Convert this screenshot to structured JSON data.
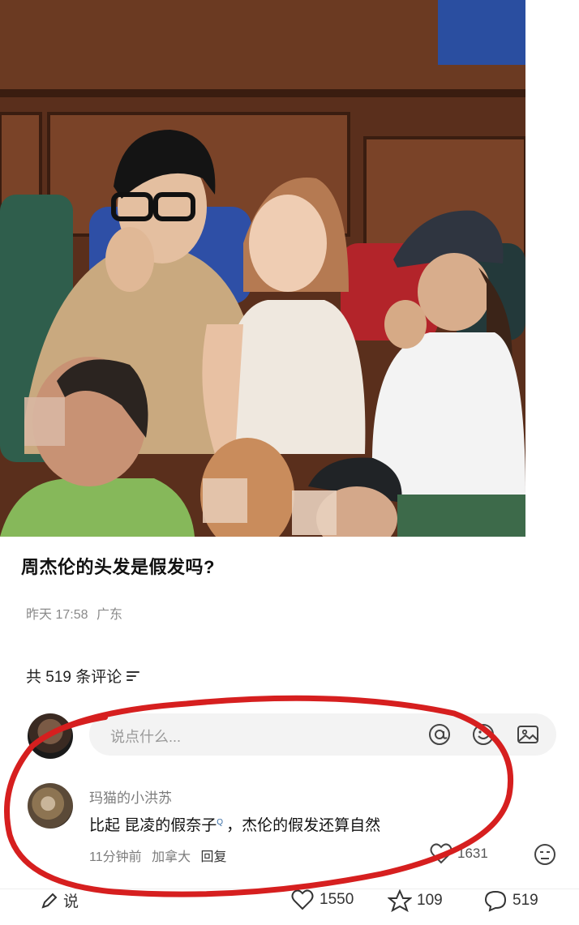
{
  "post": {
    "title": "周杰伦的头发是假发吗?",
    "date": "昨天 17:58",
    "location": "广东"
  },
  "comments_header": {
    "label": "共 519 条评论"
  },
  "compose": {
    "placeholder": "说点什么..."
  },
  "comment": {
    "username": "玛猫的小洪苏",
    "text_prefix": "比起 ",
    "link_text": "昆凌的假奈子",
    "link_marker": "Q",
    "text_suffix": "，杰伦的假发还算自然",
    "time": "11分钟前",
    "location": "加拿大",
    "reply_label": "回复",
    "like_count": "1631"
  },
  "bottom_bar": {
    "comment_input_label": "说",
    "like_count": "1550",
    "star_count": "109",
    "comment_count": "519"
  },
  "colors": {
    "annotation": "#d61f1f",
    "link": "#3a6ea5"
  }
}
